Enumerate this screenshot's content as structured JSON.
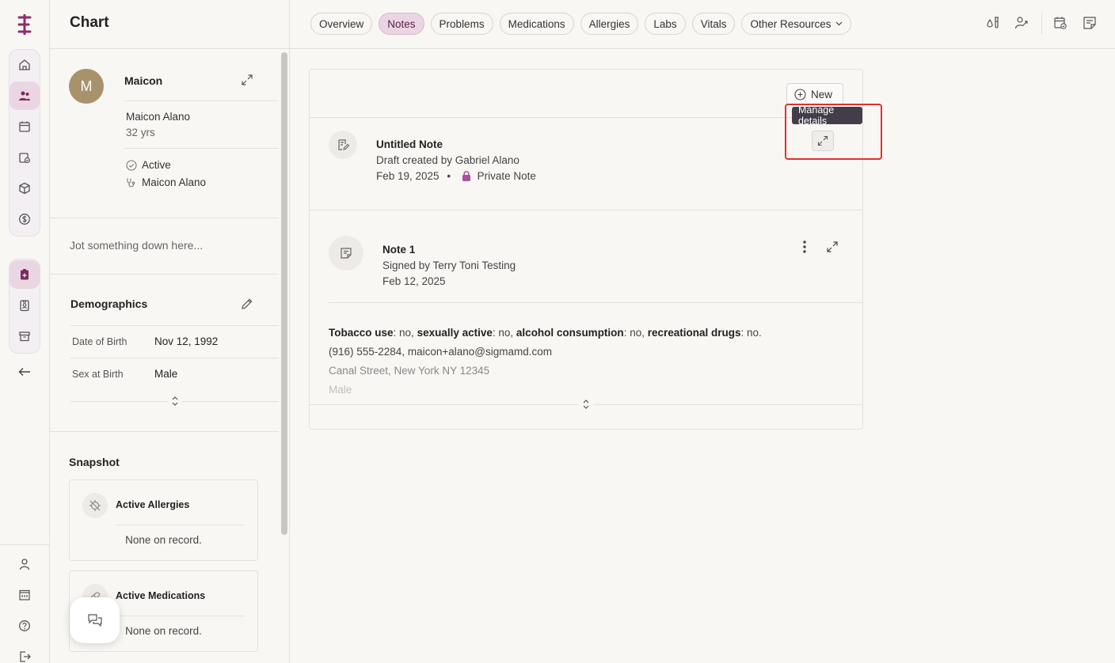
{
  "app": {
    "brand_color": "#8c2f6b",
    "accent_bg": "#ead5e3"
  },
  "rail": {
    "logo_icon": "brand-logo-icon",
    "group1": [
      "home-icon",
      "patients-icon",
      "calendar-icon",
      "tasks-icon",
      "box-icon",
      "billing-icon"
    ],
    "group2": [
      "clipboard-icon",
      "badge-icon",
      "archive-icon"
    ],
    "back_icon": "arrow-left-icon",
    "bottom": [
      "user-icon",
      "building-icon",
      "help-icon",
      "logout-icon"
    ]
  },
  "sidebar": {
    "title": "Chart",
    "patient": {
      "initial": "M",
      "display_name": "Maicon",
      "full_name": "Maicon Alano",
      "age": "32 yrs",
      "status": "Active",
      "provider": "Maicon Alano"
    },
    "jot_placeholder": "Jot something down here...",
    "demographics": {
      "title": "Demographics",
      "rows": [
        {
          "label": "Date of Birth",
          "value": "Nov 12, 1992"
        },
        {
          "label": "Sex at Birth",
          "value": "Male"
        }
      ]
    },
    "snapshot": {
      "title": "Snapshot",
      "cards": [
        {
          "title": "Active Allergies",
          "value": "None on record.",
          "icon": "allergy-icon"
        },
        {
          "title": "Active Medications",
          "value": "None on record.",
          "icon": "pill-icon"
        }
      ]
    }
  },
  "tabs": [
    {
      "label": "Overview",
      "active": false
    },
    {
      "label": "Notes",
      "active": true
    },
    {
      "label": "Problems",
      "active": false
    },
    {
      "label": "Medications",
      "active": false
    },
    {
      "label": "Allergies",
      "active": false
    },
    {
      "label": "Labs",
      "active": false
    },
    {
      "label": "Vitals",
      "active": false
    },
    {
      "label": "Other Resources",
      "active": false
    }
  ],
  "top_icons": [
    "lab-order-icon",
    "referral-icon",
    "schedule-icon",
    "note-icon"
  ],
  "notes": {
    "new_label": "New",
    "tooltip": "Manage details",
    "items": [
      {
        "title": "Untitled Note",
        "subtitle": "Draft created by Gabriel Alano",
        "date": "Feb 19, 2025",
        "separator": "•",
        "privacy": "Private Note"
      },
      {
        "title": "Note 1",
        "subtitle": "Signed by Terry Toni Testing",
        "date": "Feb 12, 2025",
        "body": {
          "k1": "Tobacco use",
          "v1": ": no, ",
          "k2": "sexually active",
          "v2": ": no, ",
          "k3": "alcohol consumption",
          "v3": ": no, ",
          "k4": "recreational drugs",
          "v4": ": no.",
          "contact": "(916) 555-2284, maicon+alano@sigmamd.com",
          "address": "Canal Street, New York NY 12345",
          "sex": "Male"
        }
      }
    ]
  }
}
